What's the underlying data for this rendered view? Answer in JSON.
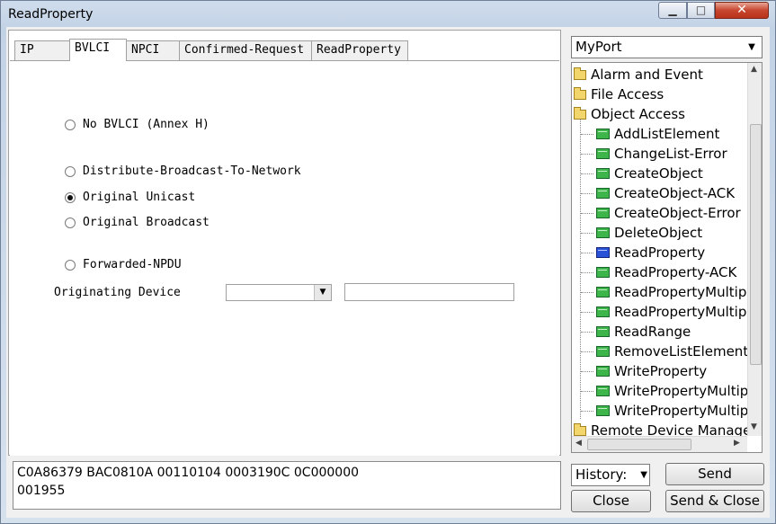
{
  "window": {
    "title": "ReadProperty",
    "controls": {
      "minimize": "▁",
      "maximize": "□",
      "close": "✕"
    }
  },
  "tabs": [
    {
      "label": "IP",
      "active": false
    },
    {
      "label": "BVLCI",
      "active": true
    },
    {
      "label": "NPCI",
      "active": false
    },
    {
      "label": "Confirmed-Request",
      "active": false
    },
    {
      "label": "ReadProperty",
      "active": false
    }
  ],
  "bvlci": {
    "options": [
      {
        "label": "No BVLCI (Annex H)",
        "checked": false
      },
      {
        "label": "Distribute-Broadcast-To-Network",
        "checked": false
      },
      {
        "label": "Original Unicast",
        "checked": true
      },
      {
        "label": "Original Broadcast",
        "checked": false
      },
      {
        "label": "Forwarded-NPDU",
        "checked": false
      }
    ],
    "originating_device_label": "Originating Device",
    "originating_device_select": "",
    "originating_device_address": ""
  },
  "port": {
    "selected": "MyPort"
  },
  "tree": {
    "items": [
      {
        "label": "Alarm and Event",
        "kind": "folder"
      },
      {
        "label": "File Access",
        "kind": "folder"
      },
      {
        "label": "Object Access",
        "kind": "folder-open"
      },
      {
        "label": "AddListElement",
        "kind": "service"
      },
      {
        "label": "ChangeList-Error",
        "kind": "service"
      },
      {
        "label": "CreateObject",
        "kind": "service"
      },
      {
        "label": "CreateObject-ACK",
        "kind": "service"
      },
      {
        "label": "CreateObject-Error",
        "kind": "service"
      },
      {
        "label": "DeleteObject",
        "kind": "service"
      },
      {
        "label": "ReadProperty",
        "kind": "service-selected"
      },
      {
        "label": "ReadProperty-ACK",
        "kind": "service"
      },
      {
        "label": "ReadPropertyMultip",
        "kind": "service"
      },
      {
        "label": "ReadPropertyMultip",
        "kind": "service"
      },
      {
        "label": "ReadRange",
        "kind": "service"
      },
      {
        "label": "RemoveListElement",
        "kind": "service"
      },
      {
        "label": "WriteProperty",
        "kind": "service"
      },
      {
        "label": "WritePropertyMultip",
        "kind": "service"
      },
      {
        "label": "WritePropertyMultip",
        "kind": "service"
      },
      {
        "label": "Remote Device Manage",
        "kind": "folder"
      }
    ]
  },
  "hex": {
    "line1": "C0A86379 BAC0810A 00110104 0003190C 0C000000",
    "line2": "001955"
  },
  "footer": {
    "history_label": "History:",
    "send_label": "Send",
    "close_label": "Close",
    "send_close_label": "Send & Close"
  }
}
